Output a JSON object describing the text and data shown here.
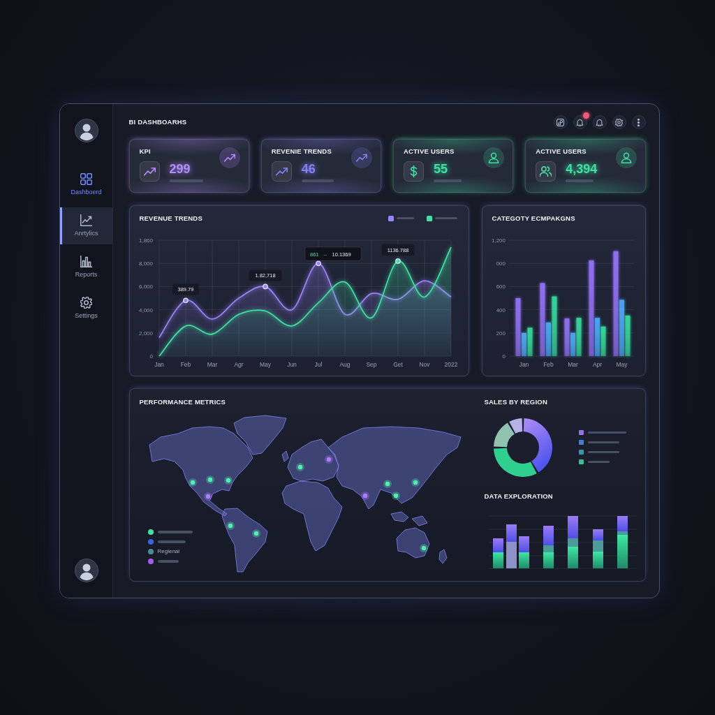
{
  "sidebar": {
    "items": [
      {
        "label": "Dashboerd",
        "selected": false,
        "highlighted": true
      },
      {
        "label": "Anrtylics",
        "selected": true,
        "highlighted": false
      },
      {
        "label": "Reports",
        "selected": false,
        "highlighted": false
      },
      {
        "label": "Settings",
        "selected": false,
        "highlighted": false
      }
    ]
  },
  "header": {
    "title": "BI DASHBOARHS",
    "actions": [
      {
        "badge": false
      },
      {
        "badge": true
      },
      {
        "badge": false
      },
      {
        "badge": false
      },
      {
        "badge": false
      }
    ]
  },
  "kpi_cards": [
    {
      "title": "KPI",
      "value": "299",
      "color": "#b58cff"
    },
    {
      "title": "REVENIE TRENDS",
      "value": "46",
      "color": "#8480f5"
    },
    {
      "title": "ACTIVE USERS",
      "value": "55",
      "color": "#3fe0a2"
    },
    {
      "title": "ACTIVE USERS",
      "value": "4,394",
      "color": "#3fe0a2"
    }
  ],
  "revenue_trends": {
    "chart_data": {
      "type": "area",
      "title": "REVENUE TRENDS",
      "categories": [
        "Jan",
        "Feb",
        "Mar",
        "Agr",
        "May",
        "Jun",
        "Jul",
        "Aug",
        "Sep",
        "Get",
        "Nov",
        "2022"
      ],
      "series": [
        {
          "color": "#9b82f7",
          "values": [
            1600,
            4800,
            3200,
            5000,
            6000,
            4000,
            8000,
            3600,
            5400,
            4900,
            6500,
            5100
          ]
        },
        {
          "color": "#3fe0a2",
          "values": [
            0,
            2600,
            1900,
            3600,
            3900,
            2600,
            4600,
            6400,
            3300,
            8200,
            5100,
            9400
          ]
        }
      ],
      "stacked": false,
      "grid": true,
      "ylim": [
        0,
        10000
      ],
      "yticks": [
        0,
        {
          "value": 2000,
          "label": "2,000"
        },
        {
          "value": 4000,
          "label": "4,000"
        },
        {
          "value": 6000,
          "label": "6,000"
        },
        {
          "value": 8000,
          "label": "8,000"
        }
      ],
      "annotations": [
        {
          "x": "Feb",
          "y": 4800,
          "text": "389.79"
        },
        {
          "x": "May",
          "y": 6000,
          "text": "1.82,718"
        },
        {
          "x": "Get",
          "y": 8200,
          "text": "1136.788"
        }
      ]
    },
    "y_axis_extra_labels": [
      "1,860"
    ],
    "tooltip": {
      "key": "861",
      "separator": "--",
      "value": "10.1369"
    }
  },
  "category_chart": {
    "chart_data": {
      "type": "bar",
      "title": "CATEGOTY ECMPAKGNS",
      "categories": [
        "Jan",
        "Feb",
        "Mar",
        "Apr",
        "May"
      ],
      "series": [
        {
          "color": "#8f6ff0",
          "values": [
            500,
            630,
            325,
            825,
            905
          ]
        },
        {
          "color": "#4aa3f0",
          "values": [
            200,
            290,
            200,
            330,
            485
          ]
        },
        {
          "color": "#34d399",
          "values": [
            245,
            515,
            330,
            255,
            350
          ]
        }
      ],
      "grid": true,
      "ylim": [
        0,
        1000
      ],
      "yticks": [
        0,
        200,
        400,
        600
      ]
    },
    "y_axis_extra_labels": [
      "1,200",
      "000"
    ]
  },
  "performance_metrics": {
    "title": "PERFORMANCE METRICS",
    "legend": [
      {
        "color": "#3fe0a2"
      },
      {
        "color": "#3d63d9"
      },
      {
        "color": "#4b8a96",
        "label": "Regienal"
      },
      {
        "color": "#a35cf5"
      }
    ]
  },
  "sales_by_region": {
    "title": "SALES BY REGION",
    "legend": [
      {
        "color": "#9a6ff0"
      },
      {
        "color": "#3f7fe0"
      },
      {
        "color": "#2f9aa8"
      },
      {
        "color": "#2fc48a"
      }
    ]
  },
  "data_exploration": {
    "title": "DATA EXPLORATION"
  }
}
